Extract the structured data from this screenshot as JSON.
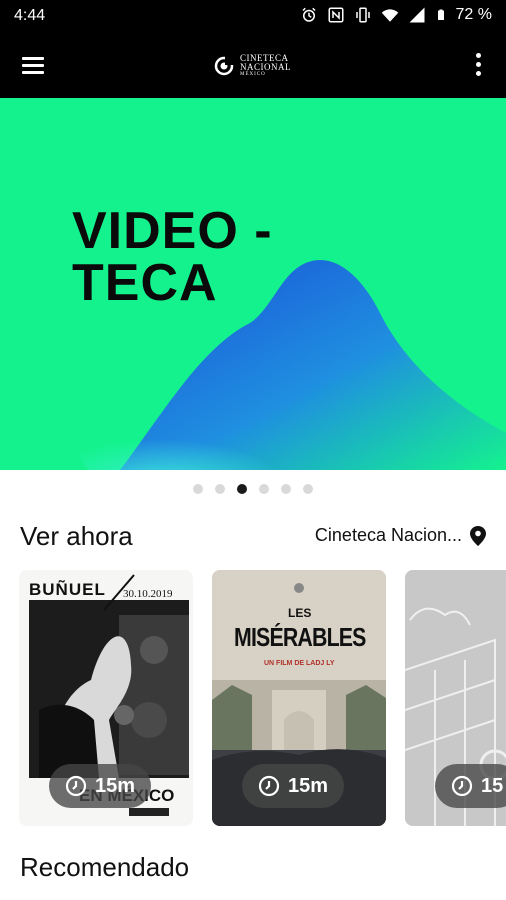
{
  "status_bar": {
    "time": "4:44",
    "battery": "72 %",
    "icons": [
      "alarm-icon",
      "nfc-icon",
      "vibrate-icon",
      "wifi-icon",
      "signal-icon",
      "battery-icon"
    ]
  },
  "app_bar": {
    "menu_icon": "hamburger-menu-icon",
    "logo_line1": "CINETECA",
    "logo_line2": "NACIONAL",
    "logo_line3": "MÉXICO",
    "more_icon": "more-vert-icon"
  },
  "hero": {
    "title_line1": "VIDEO -",
    "title_line2": "TECA",
    "background_color": "#14f28e",
    "slide_count": 6,
    "active_slide": 3
  },
  "now_watching": {
    "title": "Ver ahora",
    "location": "Cineteca Nacion...",
    "location_icon": "location-pin-icon",
    "items": [
      {
        "poster_top": "BUÑUEL",
        "poster_date": "30.10.2019",
        "poster_bottom": "EN MÉXICO",
        "duration": "15m"
      },
      {
        "poster_top": "LES",
        "poster_title": "MISÉRABLES",
        "poster_sub": "UN FILM DE LADJ LY",
        "duration": "15m"
      },
      {
        "duration": "15"
      }
    ]
  },
  "recommended": {
    "title": "Recomendado"
  },
  "colors": {
    "accent_green": "#14f28e",
    "bar_black": "#000000"
  }
}
